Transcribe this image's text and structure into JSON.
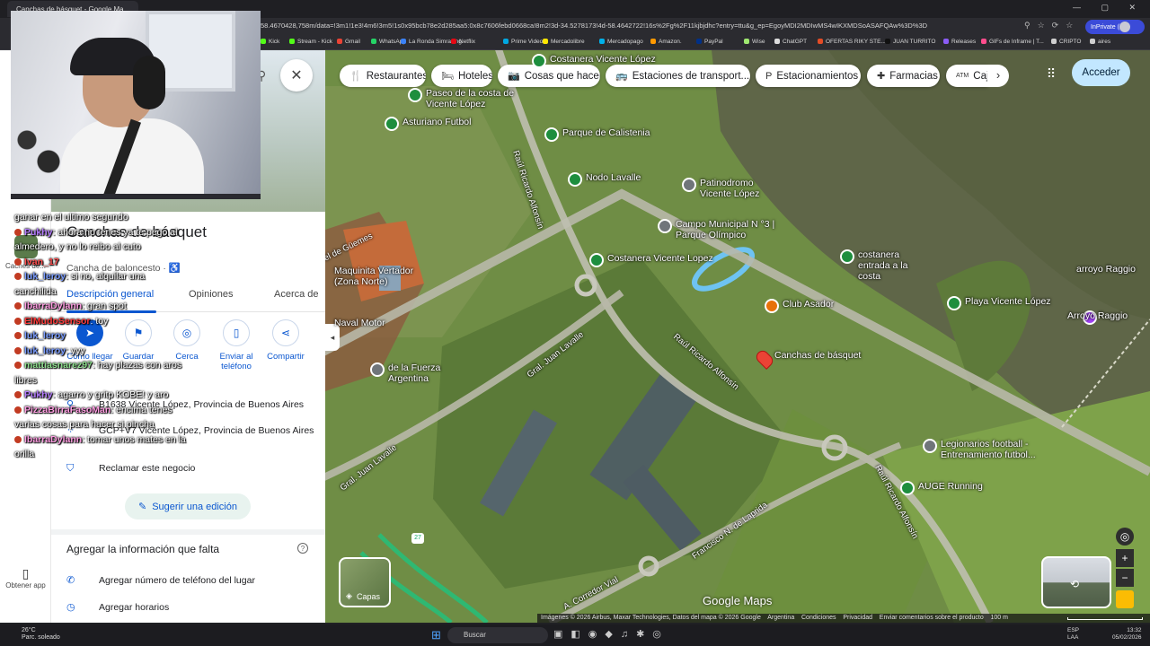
{
  "browser": {
    "tab_title": "Canchas de básquet - Google Ma...",
    "url": "58.4670428,758m/data=!3m1!1e3!4m6!3m5!1s0x95bcb78e2d285aa5:0x8c7606febd0668ca!8m2!3d-34.5278173!4d-58.4642722!16s%2Fg%2F11kjbjdhc?entry=ttu&g_ep=EgoyMDI2MDIwMS4wIKXMDSoASAFQAw%3D%3D",
    "inprivate_label": "InPrivate (2)",
    "bookmarks": [
      {
        "label": "Kick",
        "color": "#53fc18"
      },
      {
        "label": "Stream - Kick",
        "color": "#53fc18"
      },
      {
        "label": "Gmail",
        "color": "#ea4335"
      },
      {
        "label": "WhatsApp",
        "color": "#25d366"
      },
      {
        "label": "La Ronda Simracing",
        "color": "#3b82f6"
      },
      {
        "label": "Netflix",
        "color": "#e50914"
      },
      {
        "label": "Prime Video",
        "color": "#00a8e1"
      },
      {
        "label": "Mercadolibre",
        "color": "#ffe600"
      },
      {
        "label": "Mercadopago",
        "color": "#00b1ea"
      },
      {
        "label": "Amazon.",
        "color": "#ff9900"
      },
      {
        "label": "PayPal",
        "color": "#003087"
      },
      {
        "label": "Wise",
        "color": "#9fe870"
      },
      {
        "label": "ChatGPT",
        "color": "#dddddd"
      },
      {
        "label": "OFERTAS RIKY STE...",
        "color": "#e34c26"
      },
      {
        "label": "JUAN TURRITO",
        "color": "#111111"
      },
      {
        "label": "Releases",
        "color": "#8b5cf6"
      },
      {
        "label": "GIFs de Inframe | T...",
        "color": "#ff4d8d"
      },
      {
        "label": "CRIPTO",
        "color": "#cfcfcf"
      },
      {
        "label": "aires",
        "color": "#cfcfcf"
      }
    ]
  },
  "rail": {
    "obtener_app": "Obtener app",
    "recent_label": "Caches de..."
  },
  "place": {
    "title": "Canchas de básquet",
    "subtitle": "Cancha de baloncesto · ♿",
    "tabs": [
      "Descripción general",
      "Opiniones",
      "Acerca de"
    ],
    "actions": [
      "Cómo llegar",
      "Guardar",
      "Cerca",
      "Enviar al teléfono",
      "Compartir"
    ],
    "address": "B1638 Vicente López, Provincia de Buenos Aires",
    "plus_code": "GCP+V7 Vicente López, Provincia de Buenos Aires",
    "claim": "Reclamar este negocio",
    "suggest_edit": "Sugerir una edición",
    "missing_info_title": "Agregar la información que falta",
    "add_phone": "Agregar número de teléfono del lugar",
    "add_hours": "Agregar horarios"
  },
  "chat": [
    {
      "user": "",
      "text": "ganar en el ultimo segundo",
      "color": "#ffffff"
    },
    {
      "user": "Pukhy",
      "text": ": ahora no tenes ya te pego al",
      "color": "#b57cff"
    },
    {
      "user": "",
      "text": "almedero, y no lo reibo al cuto",
      "color": "#ffffff"
    },
    {
      "user": "Ivan_17",
      "text": "",
      "color": "#ff4d4d"
    },
    {
      "user": "luk_leroy",
      "text": ": si no, alquilar una",
      "color": "#7a9cff"
    },
    {
      "user": "",
      "text": "canchilida",
      "color": "#ffffff"
    },
    {
      "user": "IbarraDylann",
      "text": ": gran spot",
      "color": "#ff9de2"
    },
    {
      "user": "ElMudoSensor",
      "text": ": toy",
      "color": "#ff3b3b"
    },
    {
      "user": "luk_leroy",
      "text": "",
      "color": "#7a9cff"
    },
    {
      "user": "luk_leroy",
      "text": ": yyy",
      "color": "#7a9cff"
    },
    {
      "user": "mattiasnarez97",
      "text": ": hay plazas con aros",
      "color": "#8fe08f"
    },
    {
      "user": "",
      "text": "libres",
      "color": "#ffffff"
    },
    {
      "user": "Pukhy",
      "text": ": agarro y gritp KOBE! y aro",
      "color": "#b57cff"
    },
    {
      "user": "PizzaBirraFasoMan",
      "text": ": encima tenes",
      "color": "#ff9de2"
    },
    {
      "user": "",
      "text": "varias cosas para hacer si pincha",
      "color": "#ffffff"
    },
    {
      "user": "IbarraDylann",
      "text": ": tomar unos mates en la",
      "color": "#ff9de2"
    },
    {
      "user": "",
      "text": "orilla",
      "color": "#ffffff"
    }
  ],
  "map": {
    "chips": [
      {
        "label": "Restaurantes",
        "icon": "fork-knife-icon",
        "glyph": "🍴"
      },
      {
        "label": "Hoteles",
        "icon": "bed-icon",
        "glyph": "🛏"
      },
      {
        "label": "Cosas que hacer",
        "icon": "camera-icon",
        "glyph": "📷"
      },
      {
        "label": "Estaciones de transport...",
        "icon": "bus-icon",
        "glyph": "🚌"
      },
      {
        "label": "Estacionamientos",
        "icon": "parking-icon",
        "glyph": "P"
      },
      {
        "label": "Farmacias",
        "icon": "pharmacy-icon",
        "glyph": "✚"
      },
      {
        "label": "Cajer",
        "icon": "atm-icon",
        "glyph": "ATM"
      }
    ],
    "acceder": "Acceder",
    "layers": "Capas",
    "logo": "Google Maps",
    "pois": [
      {
        "label": "Costanera Vicente López",
        "type": "green"
      },
      {
        "label": "Paseo de la costa de Vicente López",
        "type": "green"
      },
      {
        "label": "Asturiano Futbol",
        "type": "green"
      },
      {
        "label": "Parque de Calistenia",
        "type": "green"
      },
      {
        "label": "Nodo Lavalle",
        "type": "green"
      },
      {
        "label": "Patinodromo Vicente López",
        "type": "gray"
      },
      {
        "label": "Campo Municipal N °3 | Parque Olímpico",
        "type": "gray"
      },
      {
        "label": "costanera entrada a la costa",
        "type": "green"
      },
      {
        "label": "Costanera Vicente Lopez",
        "type": "green"
      },
      {
        "label": "Maquinita Vertador (Zona Norte)",
        "type": "none"
      },
      {
        "label": "Naval Motor",
        "type": "none"
      },
      {
        "label": "Club Asador",
        "type": "orange"
      },
      {
        "label": "Canchas de básquet",
        "type": "red"
      },
      {
        "label": "Playa Vicente López",
        "type": "green"
      },
      {
        "label": "Arroyo Raggio",
        "type": "purple"
      },
      {
        "label": "arroyo Raggio",
        "type": "none"
      },
      {
        "label": "Legionarios football - Entrenamiento futbol...",
        "type": "gray"
      },
      {
        "label": "AUGE Running",
        "type": "green"
      },
      {
        "label": "de la Fuerza Argentina",
        "type": "gray"
      }
    ],
    "roads": [
      "Raúl Ricardo Alfonsín",
      "Gral. Juan Lavalle",
      "Raúl Ricardo Alfonsín",
      "Gral. Juan Lavalle",
      "Raúl Ricardo Alfonsín",
      "Francisco N. de Laprida",
      "A. Corredor Vial",
      "el de Güemes"
    ],
    "route_badge": "27",
    "attribution": [
      "Imágenes © 2026 Airbus, Maxar Technologies, Datos del mapa © 2026 Google",
      "Argentina",
      "Condiciones",
      "Privacidad",
      "Enviar comentarios sobre el producto",
      "100 m"
    ]
  },
  "taskbar": {
    "weather_temp": "26°C",
    "weather_desc": "Parc. soleado",
    "search": "Buscar",
    "lang": "ESP",
    "lang2": "LAA",
    "time": "13:32",
    "date": "05/02/2026"
  }
}
